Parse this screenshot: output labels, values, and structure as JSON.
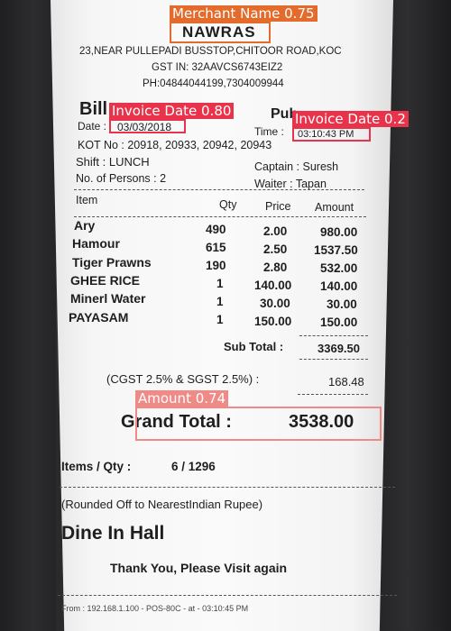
{
  "receipt": {
    "merchant": "NAWRAS",
    "address": "23,NEAR PULLEPADI BUSSTOP,CHITOOR ROAD,KOC",
    "gst": "GST IN: 32AAVCS6743EIZ2",
    "phone": "PH:04844044199,7304009944",
    "bill_title": "Bill",
    "bill_title_tail": "Pub",
    "date_label": "Date :",
    "date_value": "03/03/2018",
    "time_label": "Time :",
    "time_value": "03:10:43 PM",
    "kot": "KOT No : 20918, 20933, 20942, 20943",
    "shift": "Shift : LUNCH",
    "captain": "Captain : Suresh",
    "persons": "No. of Persons : 2",
    "waiter": "Waiter : Tapan",
    "columns": [
      "Item",
      "Qty",
      "Price",
      "Amount"
    ],
    "items": [
      {
        "name": "Ary",
        "qty": "490",
        "price": "2.00",
        "amount": "980.00"
      },
      {
        "name": "Hamour",
        "qty": "615",
        "price": "2.50",
        "amount": "1537.50"
      },
      {
        "name": "Tiger Prawns",
        "qty": "190",
        "price": "2.80",
        "amount": "532.00"
      },
      {
        "name": "GHEE RICE",
        "qty": "1",
        "price": "140.00",
        "amount": "140.00"
      },
      {
        "name": "Minerl Water",
        "qty": "1",
        "price": "30.00",
        "amount": "30.00"
      },
      {
        "name": "PAYASAM",
        "qty": "1",
        "price": "150.00",
        "amount": "150.00"
      }
    ],
    "subtotal_label": "Sub Total :",
    "subtotal_value": "3369.50",
    "tax_label": "(CGST 2.5% & SGST 2.5%) :",
    "tax_value": "168.48",
    "grand_label": "Grand Total :",
    "grand_value": "3538.00",
    "items_qty_label": "Items / Qty :",
    "items_qty_value": "6 / 1296",
    "rounded": "(Rounded Off to NearestIndian Rupee)",
    "dine": "Dine In Hall",
    "thanks": "Thank You, Please Visit again",
    "footer": "From : 192.168.1.100 - POS-80C - at - 03:10:45 PM"
  },
  "detections": [
    {
      "label": "Merchant Name 0.75",
      "color": "#e36b2c"
    },
    {
      "label": "Invoice Date 0.80",
      "color": "#e8334a"
    },
    {
      "label": "Invoice Date 0.2",
      "color": "#e8334a"
    },
    {
      "label": "Amount 0.74",
      "color": "#f08a86"
    }
  ]
}
